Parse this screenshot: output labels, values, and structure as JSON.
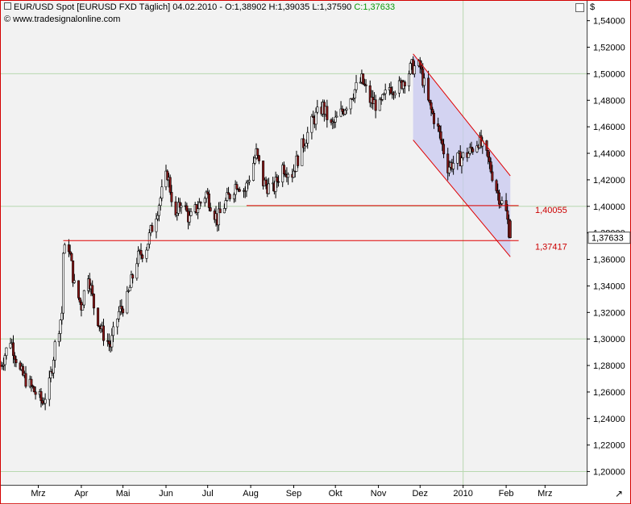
{
  "header": {
    "instrument": "EUR/USD Spot [EURUSD FXD  Täglich] 04.02.2010 - O:1,38902 H:1,39035 L:1,37590",
    "close": "C:1,37633",
    "copyright": "© www.tradesignalonline.com"
  },
  "currency_label": "$",
  "colors": {
    "up_candle": "#ffffff",
    "down_candle": "#8b1a1a",
    "wick": "#000000",
    "channel_line": "#e00000",
    "channel_fill": "#c8c8f0",
    "support_line": "#e00000",
    "grid": "#b8d8b0",
    "price_label": "#cc0000"
  },
  "chart_data": {
    "type": "candlestick",
    "title": "EUR/USD Spot [EURUSD FXD  Täglich]",
    "ylabel": "$",
    "ylim": [
      1.19,
      1.555
    ],
    "y_ticks": [
      "1,20000",
      "1,22000",
      "1,24000",
      "1,26000",
      "1,28000",
      "1,30000",
      "1,32000",
      "1,34000",
      "1,36000",
      "1,38000",
      "1,40000",
      "1,42000",
      "1,44000",
      "1,46000",
      "1,48000",
      "1,50000",
      "1,52000",
      "1,54000"
    ],
    "y_tick_values": [
      1.2,
      1.22,
      1.24,
      1.26,
      1.28,
      1.3,
      1.32,
      1.34,
      1.36,
      1.38,
      1.4,
      1.42,
      1.44,
      1.46,
      1.48,
      1.5,
      1.52,
      1.54
    ],
    "x_months": [
      "Mrz",
      "Apr",
      "Mai",
      "Jun",
      "Jul",
      "Aug",
      "Sep",
      "Okt",
      "Nov",
      "Dez",
      "2010",
      "Feb",
      "Mrz"
    ],
    "x_start": "2009-02-02",
    "x_end": "2010-03-31",
    "month_ticks": [
      "2009-03-01",
      "2009-04-01",
      "2009-05-01",
      "2009-06-01",
      "2009-07-01",
      "2009-08-01",
      "2009-09-01",
      "2009-10-01",
      "2009-11-01",
      "2009-12-01",
      "2010-01-01",
      "2010-02-01",
      "2010-03-01"
    ],
    "grid_vertical": [
      "2010-01-01"
    ],
    "grid_horizontal": [
      1.2,
      1.3,
      1.4,
      1.5
    ],
    "last_close": "1,37633",
    "last_open": 1.38902,
    "last_high": 1.39035,
    "last_low": 1.3759,
    "last_close_value": 1.37633,
    "price_path": [
      [
        "2009-02-02",
        1.28
      ],
      [
        "2009-02-09",
        1.3
      ],
      [
        "2009-02-16",
        1.275
      ],
      [
        "2009-02-23",
        1.265
      ],
      [
        "2009-03-04",
        1.252
      ],
      [
        "2009-03-09",
        1.265
      ],
      [
        "2009-03-13",
        1.295
      ],
      [
        "2009-03-18",
        1.32
      ],
      [
        "2009-03-19",
        1.365
      ],
      [
        "2009-03-23",
        1.37
      ],
      [
        "2009-03-27",
        1.34
      ],
      [
        "2009-04-01",
        1.325
      ],
      [
        "2009-04-06",
        1.35
      ],
      [
        "2009-04-10",
        1.325
      ],
      [
        "2009-04-16",
        1.305
      ],
      [
        "2009-04-22",
        1.295
      ],
      [
        "2009-04-28",
        1.32
      ],
      [
        "2009-05-04",
        1.33
      ],
      [
        "2009-05-11",
        1.36
      ],
      [
        "2009-05-18",
        1.37
      ],
      [
        "2009-05-25",
        1.395
      ],
      [
        "2009-06-02",
        1.425
      ],
      [
        "2009-06-08",
        1.39
      ],
      [
        "2009-06-12",
        1.405
      ],
      [
        "2009-06-18",
        1.39
      ],
      [
        "2009-06-24",
        1.4
      ],
      [
        "2009-06-30",
        1.41
      ],
      [
        "2009-07-08",
        1.39
      ],
      [
        "2009-07-15",
        1.405
      ],
      [
        "2009-07-22",
        1.418
      ],
      [
        "2009-07-28",
        1.412
      ],
      [
        "2009-08-05",
        1.44
      ],
      [
        "2009-08-10",
        1.418
      ],
      [
        "2009-08-17",
        1.412
      ],
      [
        "2009-08-24",
        1.43
      ],
      [
        "2009-08-31",
        1.425
      ],
      [
        "2009-09-07",
        1.445
      ],
      [
        "2009-09-15",
        1.465
      ],
      [
        "2009-09-22",
        1.475
      ],
      [
        "2009-09-28",
        1.46
      ],
      [
        "2009-10-05",
        1.47
      ],
      [
        "2009-10-13",
        1.485
      ],
      [
        "2009-10-20",
        1.495
      ],
      [
        "2009-10-26",
        1.48
      ],
      [
        "2009-11-02",
        1.475
      ],
      [
        "2009-11-09",
        1.49
      ],
      [
        "2009-11-16",
        1.49
      ],
      [
        "2009-11-25",
        1.505
      ],
      [
        "2009-12-01",
        1.505
      ],
      [
        "2009-12-07",
        1.478
      ],
      [
        "2009-12-14",
        1.458
      ],
      [
        "2009-12-21",
        1.43
      ],
      [
        "2009-12-28",
        1.435
      ],
      [
        "2010-01-05",
        1.44
      ],
      [
        "2010-01-12",
        1.45
      ],
      [
        "2010-01-19",
        1.435
      ],
      [
        "2010-01-26",
        1.41
      ],
      [
        "2010-02-01",
        1.395
      ],
      [
        "2010-02-04",
        1.376
      ]
    ],
    "channel": {
      "upper": [
        [
          "2009-11-26",
          1.515
        ],
        [
          "2010-02-04",
          1.423
        ]
      ],
      "lower": [
        [
          "2009-11-26",
          1.45
        ],
        [
          "2010-02-04",
          1.362
        ]
      ]
    },
    "support_lines": [
      {
        "from": "2009-07-29",
        "to": "2010-02-10",
        "value": 1.40055,
        "label": "1,40055"
      },
      {
        "from": "2009-03-19",
        "to": "2010-02-10",
        "value": 1.37417,
        "label": "1,37417"
      }
    ]
  }
}
